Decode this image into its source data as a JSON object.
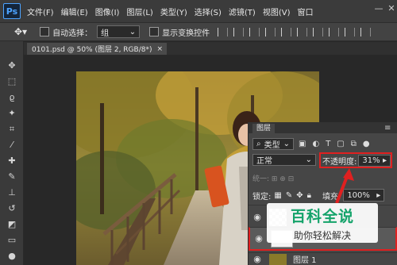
{
  "app": {
    "logo": "Ps"
  },
  "menu": [
    "文件(F)",
    "编辑(E)",
    "图像(I)",
    "图层(L)",
    "类型(Y)",
    "选择(S)",
    "滤镜(T)",
    "视图(V)",
    "窗口"
  ],
  "window_controls": {
    "minimize": "—",
    "close": "✕"
  },
  "options_bar": {
    "auto_select_label": "自动选择：",
    "auto_select_value": "组",
    "show_transform_label": "显示变换控件"
  },
  "document_tab": {
    "title": "0101.psd @ 50% (图层 2, RGB/8*)",
    "close": "×"
  },
  "layers_panel": {
    "tab_label": "图层",
    "filter_kind": "类型",
    "blend_mode": "正常",
    "opacity_label": "不透明度:",
    "opacity_value": "31%",
    "lock_label": "锁定:",
    "fill_label": "填充:",
    "fill_value": "100%",
    "layers": [
      {
        "name": ""
      },
      {
        "name": ""
      },
      {
        "name": "图层 1"
      }
    ]
  },
  "watermark": {
    "title": "百科全说",
    "subtitle": "助你轻松解决"
  },
  "colors": {
    "highlight": "#e02020",
    "accent": "#4da3ff",
    "brand_green": "#14a36a"
  }
}
